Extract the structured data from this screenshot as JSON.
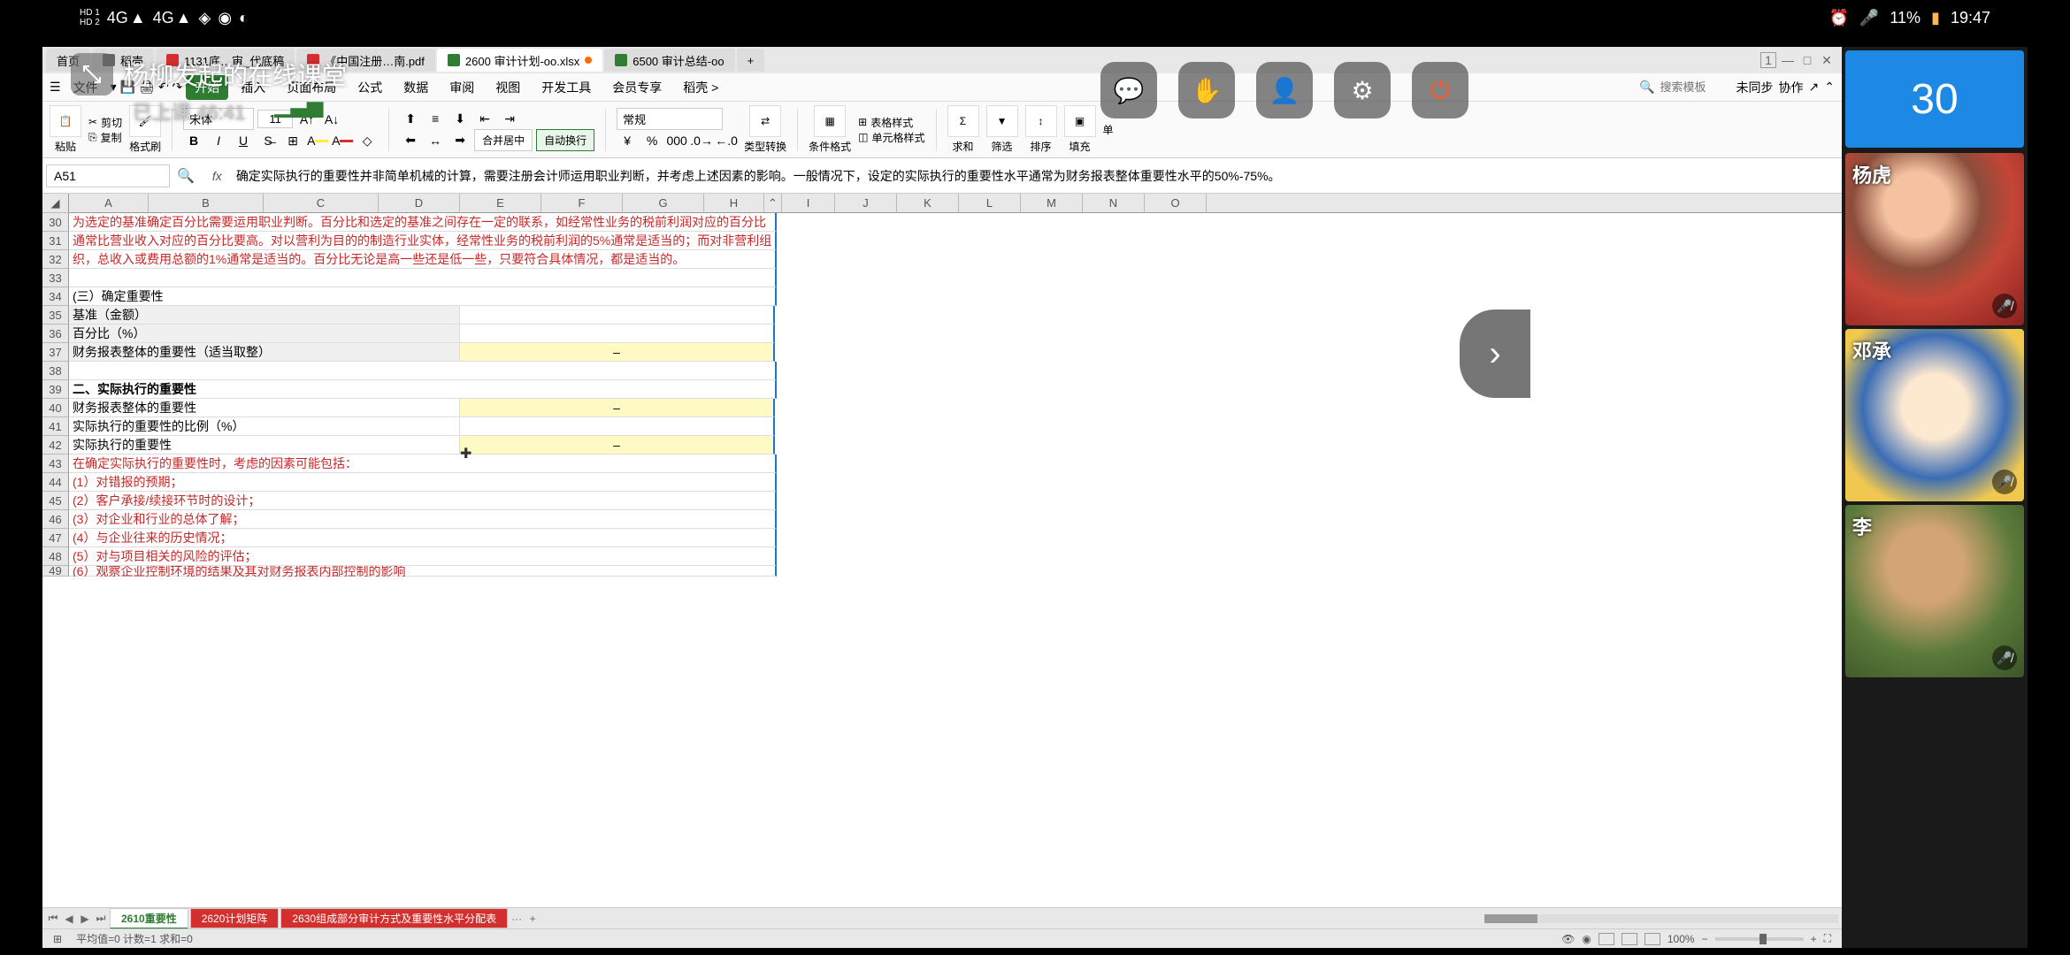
{
  "statusBar": {
    "hd1": "HD 1",
    "hd2": "HD 2",
    "sig1": "4G",
    "sig2": "4G",
    "battery": "11%",
    "time": "19:47"
  },
  "overlay": {
    "classTitle": "杨柳发起的在线课堂",
    "timerPrefix": "已上课",
    "timer": "46:41"
  },
  "tabs": {
    "t0": "首页",
    "t1": "稻壳",
    "t2": "1131底…审_代底稿",
    "t3": "《中国注册…南.pdf",
    "t4": "2600 审计计划-oo.xlsx",
    "t5": "6500 审计总结-oo",
    "plus": "+",
    "counter": "1"
  },
  "ribbon": {
    "file": "文件",
    "start": "开始",
    "insert": "插入",
    "layout": "页面布局",
    "formula": "公式",
    "data": "数据",
    "review": "审阅",
    "view": "视图",
    "dev": "开发工具",
    "member": "会员专享",
    "addon": "稻壳 >",
    "searchPlaceholder": "搜索模板",
    "unsaved": "未同步",
    "coop": "协作"
  },
  "toolbar": {
    "paste": "粘贴",
    "cut": "剪切",
    "copy": "复制",
    "formatBrush": "格式刷",
    "font": "宋体",
    "fontSize": "11",
    "mergeCenter": "合并居中",
    "autoWrap": "自动换行",
    "general": "常规",
    "typeConvert": "类型转换",
    "condFormat": "条件格式",
    "tableStyle": "表格样式",
    "cellStyle": "单元格样式",
    "sum": "求和",
    "filter": "筛选",
    "sort": "排序",
    "fill": "填充",
    "single": "单"
  },
  "formulaBar": {
    "cellRef": "A51",
    "fx": "fx",
    "text": "确定实际执行的重要性并非简单机械的计算，需要注册会计师运用职业判断，并考虑上述因素的影响。一般情况下，设定的实际执行的重要性水平通常为财务报表整体重要性水平的50%-75%。"
  },
  "columns": [
    "A",
    "B",
    "C",
    "D",
    "E",
    "F",
    "G",
    "H",
    "I",
    "J",
    "K",
    "L",
    "M",
    "N",
    "O"
  ],
  "rows": {
    "r30": {
      "num": "30",
      "text": "为选定的基准确定百分比需要运用职业判断。百分比和选定的基准之间存在一定的联系，如经常性业务的税前利润对应的百分比"
    },
    "r31": {
      "num": "31",
      "text": "通常比营业收入对应的百分比要高。对以营利为目的的制造行业实体，经常性业务的税前利润的5%通常是适当的；而对非营利组"
    },
    "r32": {
      "num": "32",
      "text": "织，总收入或费用总额的1%通常是适当的。百分比无论是高一些还是低一些，只要符合具体情况，都是适当的。"
    },
    "r33": {
      "num": "33",
      "text": ""
    },
    "r34": {
      "num": "34",
      "text": "(三）确定重要性"
    },
    "r35": {
      "num": "35",
      "text": "基准（金额）"
    },
    "r36": {
      "num": "36",
      "text": "百分比（%）"
    },
    "r37": {
      "num": "37",
      "text": "财务报表整体的重要性（适当取整）",
      "dash": "–"
    },
    "r38": {
      "num": "38",
      "text": ""
    },
    "r39": {
      "num": "39",
      "text": "二、实际执行的重要性"
    },
    "r40": {
      "num": "40",
      "text": "财务报表整体的重要性",
      "dash": "–"
    },
    "r41": {
      "num": "41",
      "text": "实际执行的重要性的比例（%）"
    },
    "r42": {
      "num": "42",
      "text": "实际执行的重要性",
      "dash": "–"
    },
    "r43": {
      "num": "43",
      "text": "在确定实际执行的重要性时，考虑的因素可能包括："
    },
    "r44": {
      "num": "44",
      "text": "(1）对错报的预期；"
    },
    "r45": {
      "num": "45",
      "text": "(2）客户承接/续接环节时的设计；"
    },
    "r46": {
      "num": "46",
      "text": "(3）对企业和行业的总体了解；"
    },
    "r47": {
      "num": "47",
      "text": "(4）与企业往来的历史情况；"
    },
    "r48": {
      "num": "48",
      "text": "(5）对与项目相关的风险的评估；"
    },
    "r49": {
      "num": "49",
      "text": "(6）观察企业控制环境的结果及其对财务报表内部控制的影响"
    }
  },
  "sheets": {
    "s1": "2610重要性",
    "s2": "2620计划矩阵",
    "s3": "2630组成部分审计方式及重要性水平分配表",
    "more": "···",
    "add": "+"
  },
  "footer": {
    "stats": "平均值=0  计数=1  求和=0",
    "zoom": "100%"
  },
  "participants": {
    "count": "30",
    "p1": "杨虎",
    "p2": "邓承",
    "p3": "李"
  }
}
